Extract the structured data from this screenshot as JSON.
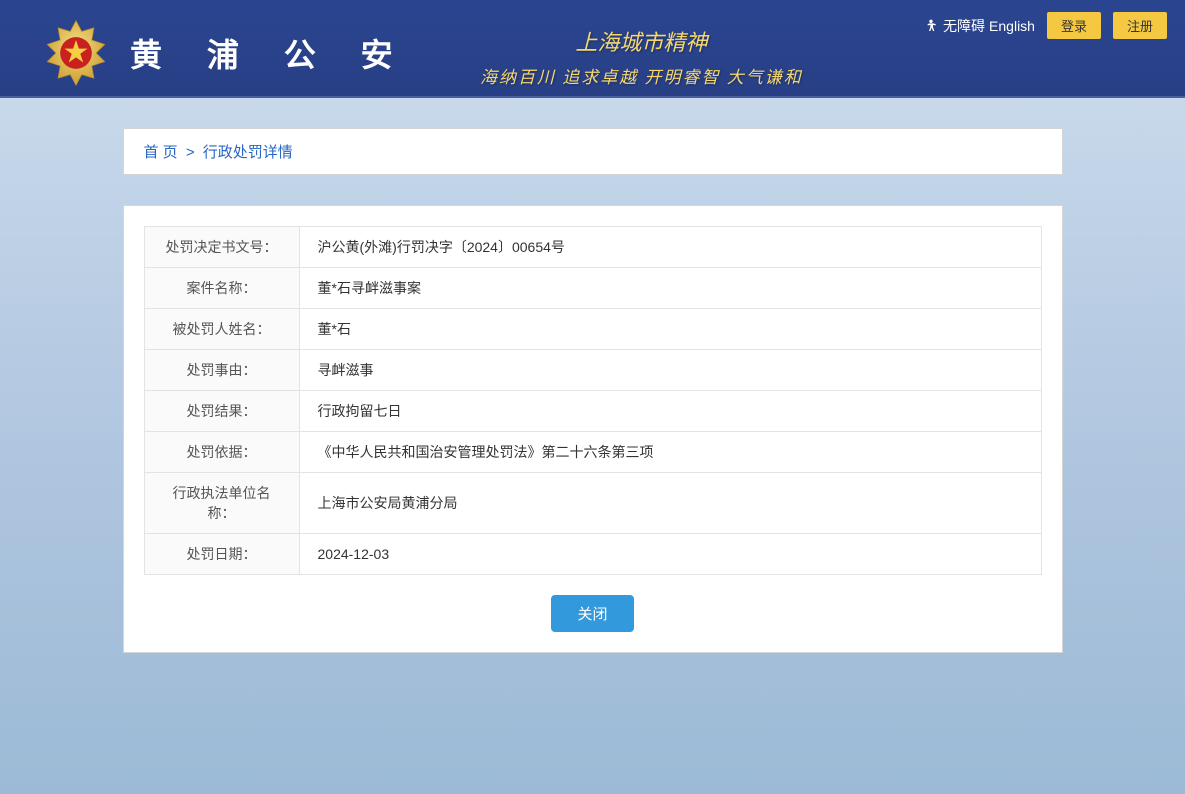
{
  "header": {
    "accessibility_label": "无障碍",
    "english_label": "English",
    "login_label": "登录",
    "register_label": "注册",
    "site_title": "黄 浦 公 安",
    "slogan_line1": "上海城市精神",
    "slogan_line2": "海纳百川 追求卓越 开明睿智 大气谦和"
  },
  "breadcrumb": {
    "home": "首 页",
    "separator": ">",
    "current": "行政处罚详情"
  },
  "detail": {
    "rows": [
      {
        "label": "处罚决定书文号：",
        "value": "沪公黄(外滩)行罚决字〔2024〕00654号"
      },
      {
        "label": "案件名称：",
        "value": "董*石寻衅滋事案"
      },
      {
        "label": "被处罚人姓名：",
        "value": "董*石"
      },
      {
        "label": "处罚事由：",
        "value": "寻衅滋事"
      },
      {
        "label": "处罚结果：",
        "value": "行政拘留七日"
      },
      {
        "label": "处罚依据：",
        "value": "《中华人民共和国治安管理处罚法》第二十六条第三项"
      },
      {
        "label": "行政执法单位名称：",
        "value": "上海市公安局黄浦分局"
      },
      {
        "label": "处罚日期：",
        "value": "2024-12-03"
      }
    ],
    "close_label": "关闭"
  }
}
